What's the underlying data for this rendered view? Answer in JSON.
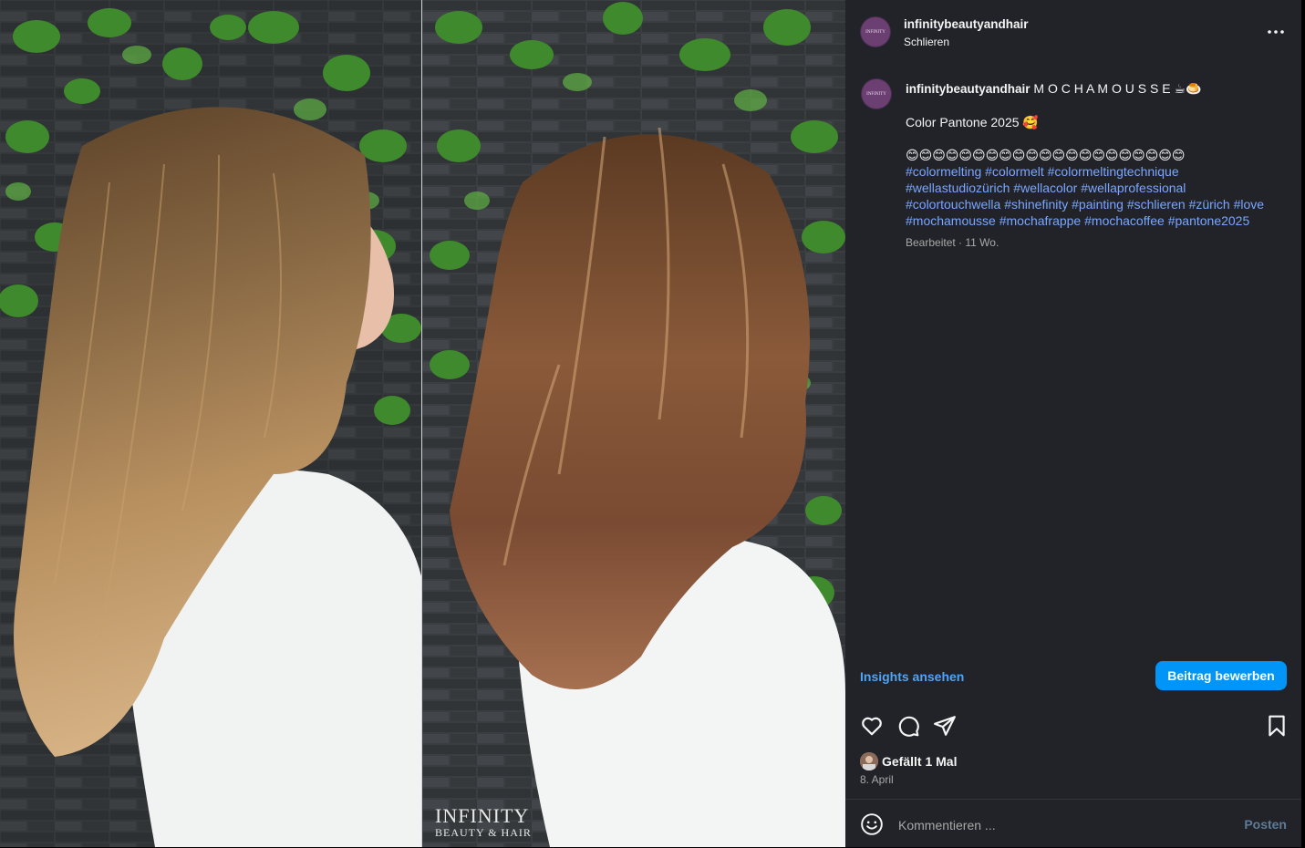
{
  "watermark": {
    "line1": "INFINITY",
    "line2": "BEAUTY & HAIR"
  },
  "header": {
    "username": "infinitybeautyandhair",
    "location": "Schlieren",
    "avatar_text": "INFINITY"
  },
  "caption": {
    "username": "infinitybeautyandhair",
    "title": "M O C H A M O U S S E ☕🍮",
    "line2": "Color Pantone 2025 🥰",
    "emoji_row": "😊😊😊😊😊😊😊😊😊😊😊😊😊😊😊😊😊😊😊😊😊",
    "hashtags": [
      "#colormelting",
      "#colormelt",
      "#colormeltingtechnique",
      "#wellastudiozürich",
      "#wellacolor",
      "#wellaprofessional",
      "#colortouchwella",
      "#shinefinity",
      "#painting",
      "#schlieren",
      "#zürich",
      "#love",
      "#mochamousse",
      "#mochafrappe",
      "#mochacoffee",
      "#pantone2025"
    ],
    "meta": "Bearbeitet · 11 Wo."
  },
  "actions": {
    "insights": "Insights ansehen",
    "promote": "Beitrag bewerben",
    "icons": [
      "heart-icon",
      "comment-icon",
      "share-icon",
      "bookmark-icon"
    ]
  },
  "likes": {
    "text": "Gefällt 1 Mal"
  },
  "date": "8. April",
  "comment": {
    "placeholder": "Kommentieren ...",
    "post": "Posten"
  },
  "colors": {
    "accent": "#0095f6",
    "link": "#7aa6ff",
    "panel": "#212328"
  }
}
